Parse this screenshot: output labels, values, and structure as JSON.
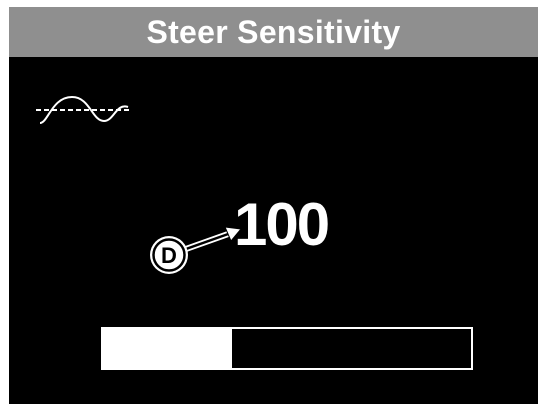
{
  "screen": {
    "title": "Steer Sensitivity",
    "mode_icon": "sine-wave-icon",
    "value": "100",
    "callout_label": "D",
    "progress_fraction": 0.35,
    "colors": {
      "background": "#000000",
      "title_bar": "#8f8f8f",
      "foreground": "#ffffff"
    }
  }
}
